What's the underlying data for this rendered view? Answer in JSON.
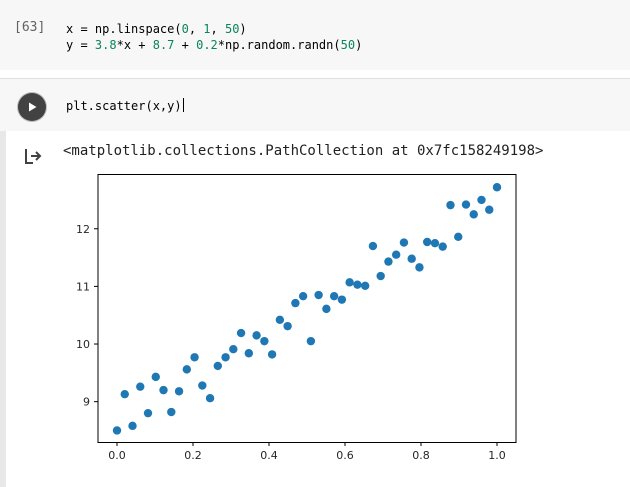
{
  "cell1": {
    "exec_count": "[63]",
    "line1_parts": [
      "x = np.linspace(",
      "0",
      ", ",
      "1",
      ", ",
      "50",
      ")"
    ],
    "line2_parts": [
      "y = ",
      "3.8",
      "*x + ",
      "8.7",
      " + ",
      "0.2",
      "*np.random.randn(",
      "50",
      ")"
    ]
  },
  "cell2": {
    "code": "plt.scatter(x,y)",
    "output_text": "<matplotlib.collections.PathCollection at 0x7fc158249198>"
  },
  "colors": {
    "marker": "#1f77b4",
    "number": "#098658",
    "run_button": "#424242"
  },
  "icons": {
    "run": "play-icon",
    "output": "output-arrow-icon"
  },
  "chart_data": {
    "type": "scatter",
    "title": "",
    "xlabel": "",
    "ylabel": "",
    "xlim": [
      -0.05,
      1.05
    ],
    "ylim": [
      8.3,
      12.95
    ],
    "xticks": [
      0.0,
      0.2,
      0.4,
      0.6,
      0.8,
      1.0
    ],
    "xtick_labels": [
      "0.0",
      "0.2",
      "0.4",
      "0.6",
      "0.8",
      "1.0"
    ],
    "yticks": [
      9,
      10,
      11,
      12
    ],
    "ytick_labels": [
      "9",
      "10",
      "11",
      "12"
    ],
    "grid": false,
    "series": [
      {
        "x": [
          0.0,
          0.0204,
          0.0408,
          0.0612,
          0.0816,
          0.102,
          0.1224,
          0.1429,
          0.1633,
          0.1837,
          0.2041,
          0.2245,
          0.2449,
          0.2653,
          0.2857,
          0.3061,
          0.3265,
          0.3469,
          0.3673,
          0.3878,
          0.4082,
          0.4286,
          0.449,
          0.4694,
          0.4898,
          0.5102,
          0.5306,
          0.551,
          0.5714,
          0.5918,
          0.6122,
          0.6327,
          0.6531,
          0.6735,
          0.6939,
          0.7143,
          0.7347,
          0.7551,
          0.7755,
          0.7959,
          0.8163,
          0.8367,
          0.8571,
          0.8776,
          0.898,
          0.9184,
          0.9388,
          0.9592,
          0.9796,
          1.0
        ],
        "y": [
          8.5,
          9.13,
          8.58,
          9.26,
          8.8,
          9.43,
          9.2,
          8.82,
          9.18,
          9.56,
          9.77,
          9.28,
          9.06,
          9.62,
          9.77,
          9.91,
          10.19,
          9.84,
          10.15,
          10.05,
          9.82,
          10.42,
          10.31,
          10.71,
          10.83,
          10.05,
          10.85,
          10.61,
          10.83,
          10.77,
          11.07,
          11.03,
          11.01,
          11.7,
          11.18,
          11.43,
          11.55,
          11.76,
          11.48,
          11.33,
          11.77,
          11.75,
          11.69,
          12.41,
          11.86,
          12.42,
          12.25,
          12.5,
          12.33,
          12.72
        ]
      }
    ]
  }
}
